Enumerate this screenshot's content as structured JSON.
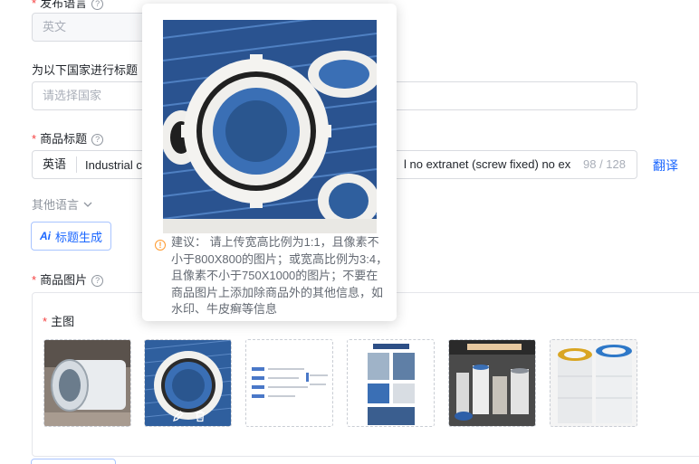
{
  "publish_language": {
    "label": "发布语言",
    "value": "英文"
  },
  "country_title": {
    "label": "为以下国家进行标题",
    "placeholder": "请选择国家"
  },
  "product_title": {
    "label": "商品标题",
    "lang": "英语",
    "value_start": "Industrial c",
    "value_end": "l  no  extranet (screw fixed) no ex",
    "counter": "98 / 128",
    "translate": "翻译"
  },
  "other_languages": {
    "label": "其他语言"
  },
  "ai_button": {
    "badge": "Ai",
    "label": "标题生成"
  },
  "product_images": {
    "label": "商品图片",
    "main_label": "主图",
    "images": [
      {
        "icon": "cylinder-filter"
      },
      {
        "icon": "blue-pleated-filter"
      },
      {
        "icon": "spec-table"
      },
      {
        "icon": "product-poster"
      },
      {
        "icon": "factory-banner"
      },
      {
        "icon": "filter-stack"
      }
    ]
  },
  "tooltip": {
    "text": "建议： 请上传宽高比例为1:1，且像素不小于800X800的图片；或宽高比例为3:4，且像素不小于750X1000的图片；不要在商品图片上添加除商品外的其他信息，如水印、牛皮癣等信息"
  },
  "colors": {
    "accent": "#1a66ff",
    "required": "#f53f3f",
    "warning": "#ff9a2e",
    "filter_blue": "#3a6fb5"
  }
}
